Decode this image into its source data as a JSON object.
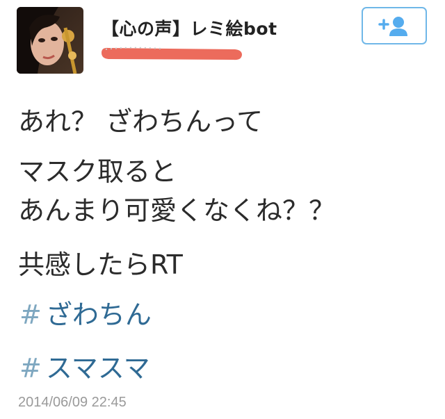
{
  "author": {
    "display_name": "【心の声】レミ絵bot",
    "avatar_icon": "profile-photo"
  },
  "follow_button": {
    "icon": "add-user-icon",
    "accent_color": "#55acee"
  },
  "tweet": {
    "lines": [
      "あれ？ ざわちんって",
      "マスク取ると",
      "あんまり可愛くなくね？？",
      "共感したらRT"
    ],
    "hashtags": [
      {
        "hash": "#",
        "tag": "ざわちん"
      },
      {
        "hash": "#",
        "tag": "スマスマ"
      }
    ],
    "timestamp": "2014/06/09 22:45"
  },
  "colors": {
    "hashtag": "#2f6a94",
    "redaction": "#ec6b5c"
  }
}
